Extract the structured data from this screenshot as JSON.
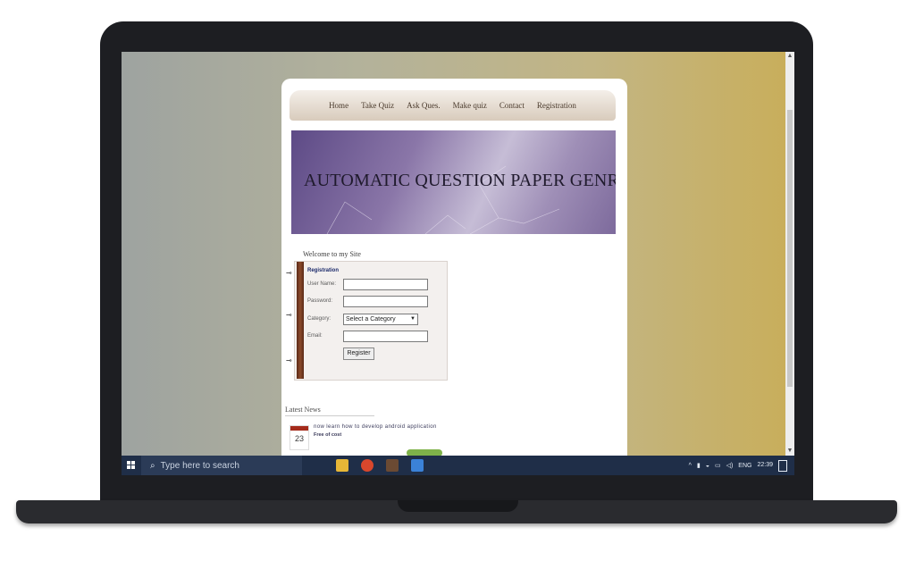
{
  "nav": {
    "items": [
      "Home",
      "Take Quiz",
      "Ask Ques.",
      "Make quiz",
      "Contact",
      "Registration"
    ]
  },
  "banner": {
    "title": "AUTOMATIC QUESTION PAPER GENRATOR"
  },
  "welcome": "Welcome to my Site",
  "registration": {
    "title": "Registration",
    "username_label": "User Name:",
    "password_label": "Password:",
    "category_label": "Category:",
    "category_selected": "Select a Category",
    "email_label": "Email:",
    "register_button": "Register"
  },
  "news": {
    "heading": "Latest News",
    "day": "23",
    "text": "now learn how to develop android application",
    "sub": "Free of cost"
  },
  "taskbar": {
    "search_placeholder": "Type here to search",
    "language": "ENG",
    "time": "22:39"
  },
  "colors": {
    "accent": "#1f2e48",
    "banner": "#8a76a8",
    "binding": "#8b4a2a"
  }
}
